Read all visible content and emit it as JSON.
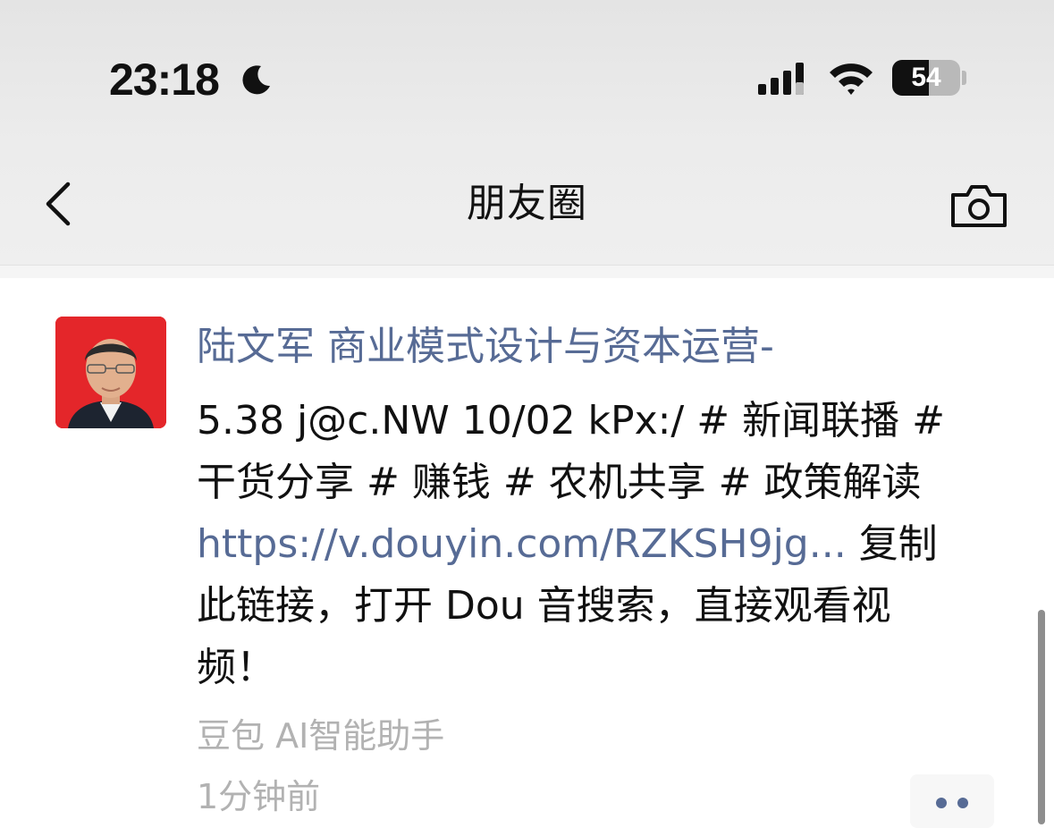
{
  "status_bar": {
    "time": "23:18",
    "battery_level": "54",
    "battery_fraction": 0.54,
    "icons": [
      "moon-icon",
      "signal-icon",
      "wifi-icon",
      "battery-icon"
    ]
  },
  "nav": {
    "back_icon": "chevron-left-icon",
    "title": "朋友圈",
    "camera_icon": "camera-icon"
  },
  "post": {
    "author": "陆文军  商业模式设计与资本运营-",
    "line1": "5.38 j@c.NW 10/02 kPx:/ # 新闻联播 #",
    "line2": "干货分享 # 赚钱 # 农机共享 # 政策解读",
    "link": "https://v.douyin.com/RZKSH9jg...",
    "line3_suffix": "复制",
    "line4": "此链接，打开 Dou 音搜索，直接观看视",
    "line5": "频！",
    "source": "豆包 AI智能助手",
    "time_ago": "1分钟前",
    "more_icon": "more-dots-icon"
  },
  "colors": {
    "link_blue": "#576b95",
    "meta_gray": "#b2b2b2",
    "avatar_red": "#e4262a"
  }
}
